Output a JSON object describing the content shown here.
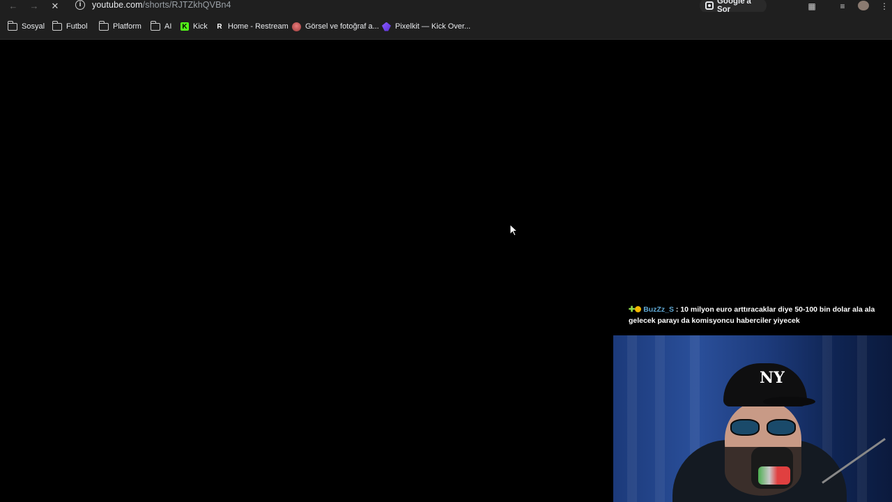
{
  "browser": {
    "url_host": "youtube.com",
    "url_path": "/shorts/RJTZkhQVBn4",
    "ask_google_label": "Google'a Sor"
  },
  "bookmarks": [
    {
      "label": "Sosyal",
      "icon": "folder-icon"
    },
    {
      "label": "Futbol",
      "icon": "folder-icon"
    },
    {
      "label": "Platform",
      "icon": "folder-icon"
    },
    {
      "label": "AI",
      "icon": "folder-icon"
    },
    {
      "label": "Kick",
      "icon": "kick-icon"
    },
    {
      "label": "Home - Restream",
      "icon": "restream-icon"
    },
    {
      "label": "Görsel ve fotoğraf a...",
      "icon": "gorsel-icon"
    },
    {
      "label": "Pixelkit — Kick Over...",
      "icon": "pixelkit-icon"
    }
  ],
  "chat": {
    "username": "BuzZz_S",
    "separator": " : ",
    "message": "10 milyon euro arttıracaklar diye 50-100 bin dolar ala ala gelecek parayı da komisyoncu haberciler yiyecek",
    "badge_colors": {
      "plus": "#8ed94b",
      "coin": "#f5b800"
    }
  },
  "webcam": {
    "cap_logo": "NY"
  },
  "colors": {
    "chrome_bg": "#1f1f1f",
    "page_bg": "#000000",
    "username": "#5fa8d3"
  }
}
